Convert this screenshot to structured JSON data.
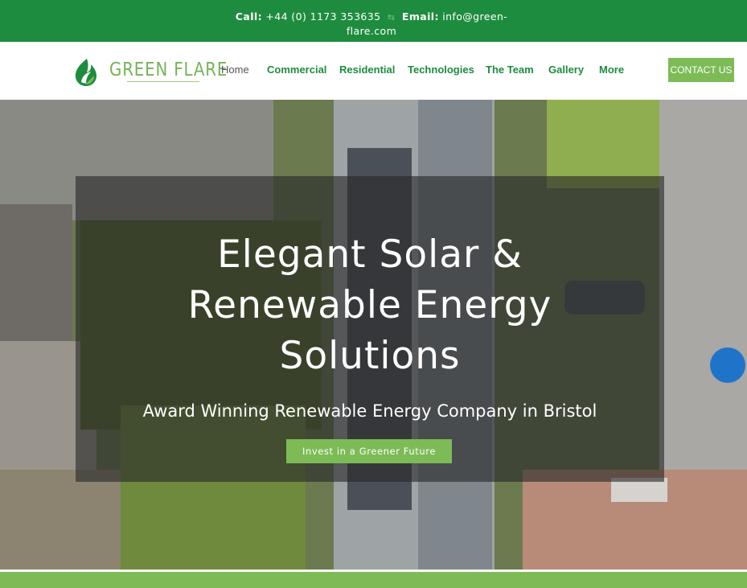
{
  "topbar": {
    "call_label": "Call:",
    "phone": "+44 (0) 1173 353635",
    "email_label": "Email:",
    "email": "info@green-flare.com"
  },
  "logo": {
    "text": "GREEN FLARE"
  },
  "nav": {
    "items": [
      "Home",
      "Commercial",
      "Residential",
      "Technologies",
      "The Team",
      "Gallery",
      "More"
    ],
    "cta": "CONTACT US"
  },
  "hero": {
    "title_line1": "Elegant Solar &",
    "title_line2": "Renewable Energy",
    "title_line3": "Solutions",
    "subtitle": "Award Winning Renewable Energy Company in Bristol",
    "button": "Invest in a Greener Future"
  },
  "colors": {
    "brand_dark": "#1e8c3e",
    "brand_light": "#7dbb57",
    "overlay": "#282828"
  }
}
